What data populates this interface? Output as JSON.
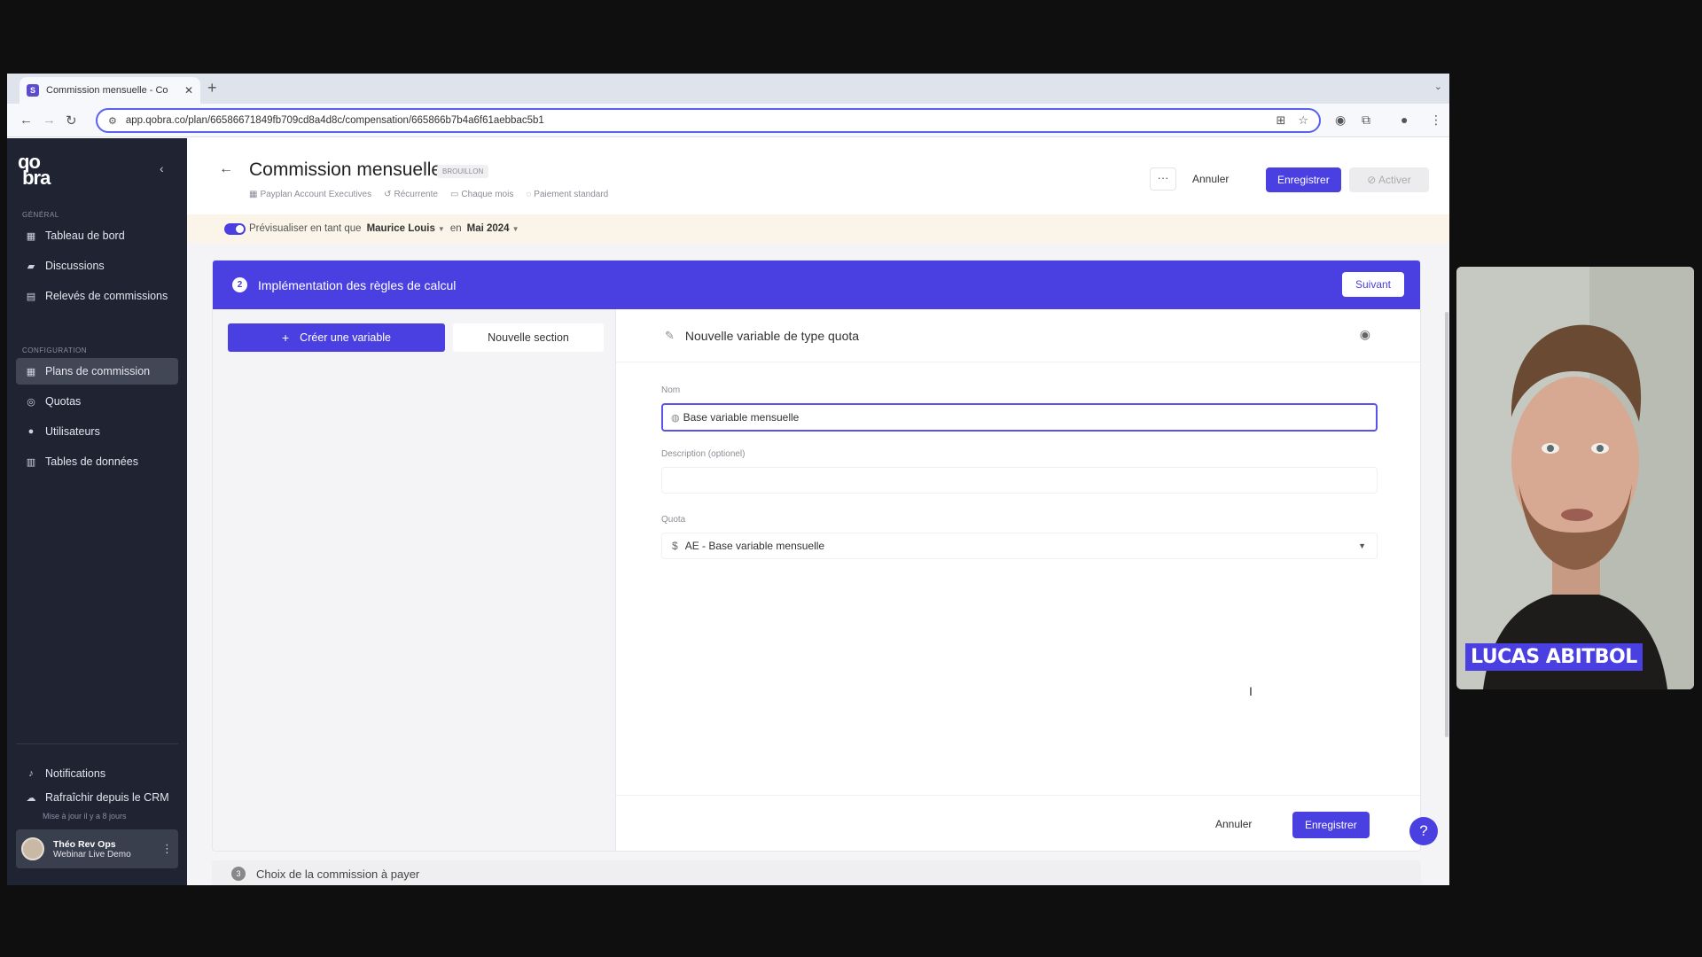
{
  "browser": {
    "tab_title": "Commission mensuelle - Co",
    "tab_favicon": "S",
    "url": "app.qobra.co/plan/66586671849fb709cd8a4d8c/compensation/665866b7b4a6f61aebbac5b1"
  },
  "sidebar": {
    "logo": "qobra",
    "section_general": "GÉNÉRAL",
    "section_config": "CONFIGURATION",
    "general_items": [
      {
        "label": "Tableau de bord",
        "icon": "grid-icon"
      },
      {
        "label": "Discussions",
        "icon": "chat-icon"
      },
      {
        "label": "Relevés de commissions",
        "icon": "document-icon"
      }
    ],
    "config_items": [
      {
        "label": "Plans de commission",
        "icon": "grid-icon",
        "active": true
      },
      {
        "label": "Quotas",
        "icon": "target-icon"
      },
      {
        "label": "Utilisateurs",
        "icon": "user-icon"
      },
      {
        "label": "Tables de données",
        "icon": "table-icon"
      }
    ],
    "notifications": "Notifications",
    "refresh": "Rafraîchir depuis le CRM",
    "refresh_sub": "Mise à jour il y a 8 jours",
    "user_name": "Théo Rev Ops",
    "user_org": "Webinar Live Demo"
  },
  "header": {
    "title": "Commission mensuelle",
    "badge": "BROUILLON",
    "meta": [
      {
        "label": "Payplan Account Executives",
        "icon": "grid-icon"
      },
      {
        "label": "Récurrente",
        "icon": "history-icon"
      },
      {
        "label": "Chaque mois",
        "icon": "calendar-icon"
      },
      {
        "label": "Paiement standard",
        "icon": "coin-icon"
      }
    ],
    "more_label": "···",
    "cancel_label": "Annuler",
    "save_label": "Enregistrer",
    "activate_label": "Activer"
  },
  "preview": {
    "prefix": "Prévisualiser en tant que",
    "user": "Maurice Louis",
    "in": "en",
    "period": "Mai 2024"
  },
  "step": {
    "number": "2",
    "title": "Implémentation des règles de calcul",
    "next_label": "Suivant",
    "create_variable": "Créer une variable",
    "new_section": "Nouvelle section",
    "variable_header": "Nouvelle variable de type quota",
    "name_label": "Nom",
    "name_value": "Base variable mensuelle",
    "description_label": "Description (optionel)",
    "quota_label": "Quota",
    "quota_value": "AE - Base variable mensuelle",
    "cancel_label": "Annuler",
    "save_label": "Enregistrer"
  },
  "next_step": {
    "number": "3",
    "title": "Choix de la commission à payer"
  },
  "help_label": "?",
  "webcam": {
    "speaker_name": "LUCAS ABITBOL"
  },
  "colors": {
    "accent": "#4a3fe0",
    "sidebar_bg": "#1f2332",
    "preview_bar": "#fbf5e9"
  }
}
